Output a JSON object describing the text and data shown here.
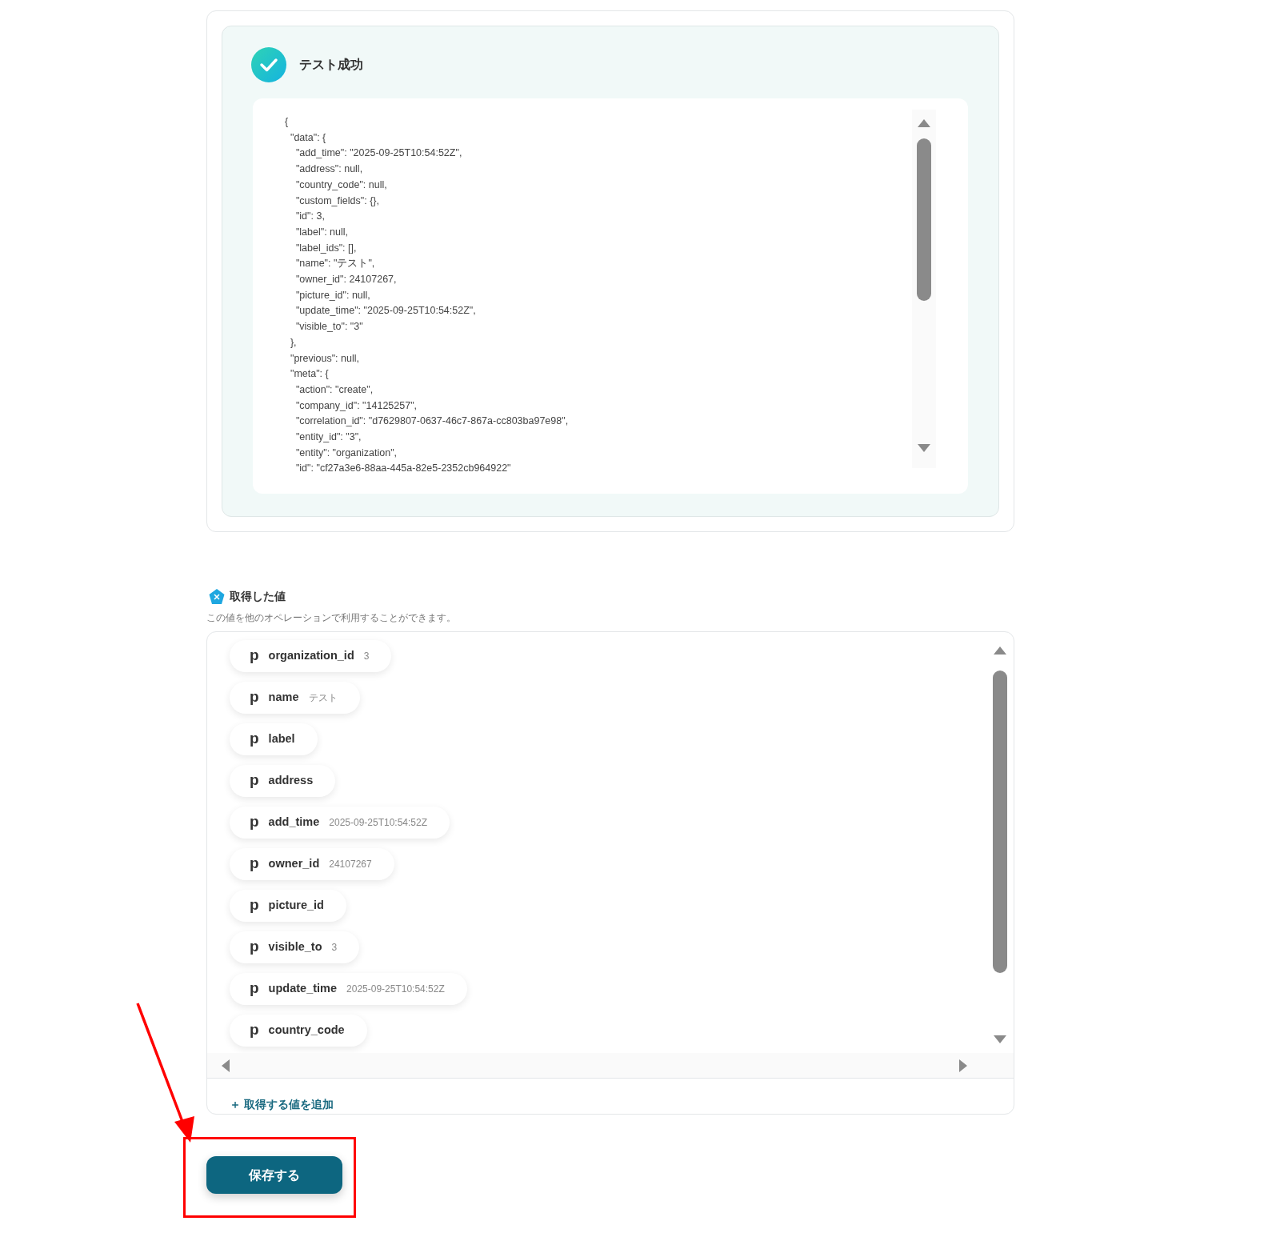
{
  "test_result": {
    "title": "テスト成功",
    "success": true,
    "code_lines": [
      "{",
      "  \"data\": {",
      "    \"add_time\": \"2025-09-25T10:54:52Z\",",
      "    \"address\": null,",
      "    \"country_code\": null,",
      "    \"custom_fields\": {},",
      "    \"id\": 3,",
      "    \"label\": null,",
      "    \"label_ids\": [],",
      "    \"name\": \"テスト\",",
      "    \"owner_id\": 24107267,",
      "    \"picture_id\": null,",
      "    \"update_time\": \"2025-09-25T10:54:52Z\",",
      "    \"visible_to\": \"3\"",
      "  },",
      "  \"previous\": null,",
      "  \"meta\": {",
      "    \"action\": \"create\",",
      "    \"company_id\": \"14125257\",",
      "    \"correlation_id\": \"d7629807-0637-46c7-867a-cc803ba97e98\",",
      "    \"entity_id\": \"3\",",
      "    \"entity\": \"organization\",",
      "    \"id\": \"cf27a3e6-88aa-445a-82e5-2352cb964922\""
    ]
  },
  "values_section": {
    "title": "取得した値",
    "description": "この値を他のオペレーションで利用することができます。",
    "items": [
      {
        "badge": "p",
        "name": "organization_id",
        "value": "3"
      },
      {
        "badge": "p",
        "name": "name",
        "value": "テスト"
      },
      {
        "badge": "p",
        "name": "label"
      },
      {
        "badge": "p",
        "name": "address"
      },
      {
        "badge": "p",
        "name": "add_time",
        "value": "2025-09-25T10:54:52Z"
      },
      {
        "badge": "p",
        "name": "owner_id",
        "value": "24107267"
      },
      {
        "badge": "p",
        "name": "picture_id"
      },
      {
        "badge": "p",
        "name": "visible_to",
        "value": "3"
      },
      {
        "badge": "p",
        "name": "update_time",
        "value": "2025-09-25T10:54:52Z"
      },
      {
        "badge": "p",
        "name": "country_code"
      }
    ],
    "add_link": "＋ 取得する値を追加"
  },
  "save_button": {
    "label": "保存する",
    "highlighted": true
  }
}
